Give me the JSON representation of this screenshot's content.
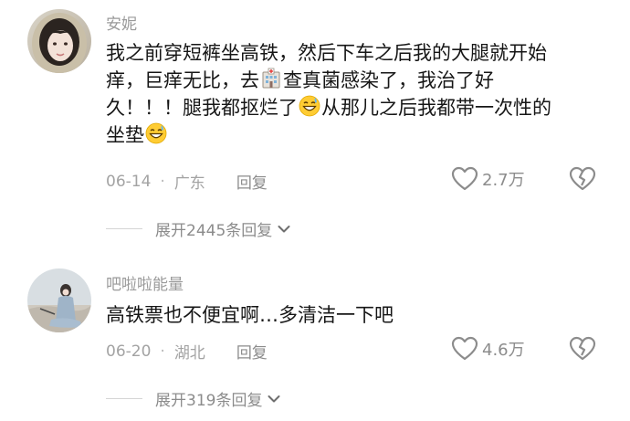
{
  "comments": [
    {
      "username": "安妮",
      "lines": [
        {
          "text_a": "我之前穿短裤坐高铁，然后下车之后我的大腿就开始"
        },
        {
          "text_a": "痒，巨痒无比，去",
          "emoji": "hospital-emoji",
          "text_b": "查真菌感染了，我治了好"
        },
        {
          "text_a": "久！！！腿我都抠烂了",
          "emoji": "grin-sweat-emoji",
          "text_b": "从那儿之后我都带一次性的"
        },
        {
          "text_a": "坐垫",
          "emoji": "grin-sweat-emoji",
          "text_b": ""
        }
      ],
      "date": "06-14",
      "separator": "·",
      "location": "广东",
      "reply_label": "回复",
      "likes": "2.7万",
      "expand_label": "展开2445条回复"
    },
    {
      "username": "吧啦啦能量",
      "lines": [
        {
          "text_a": "高铁票也不便宜啊…多清洁一下吧"
        }
      ],
      "date": "06-20",
      "separator": "·",
      "location": "湖北",
      "reply_label": "回复",
      "likes": "4.6万",
      "expand_label": "展开319条回复"
    }
  ],
  "icons": {
    "like": "heart-outline-icon",
    "dislike": "broken-heart-icon",
    "expand": "chevron-down-icon"
  },
  "colors": {
    "username": "#9a9a9a",
    "content": "#161616",
    "meta": "#a3a3a3",
    "icon": "#8c8c8c",
    "divider": "#d5d5d5"
  }
}
